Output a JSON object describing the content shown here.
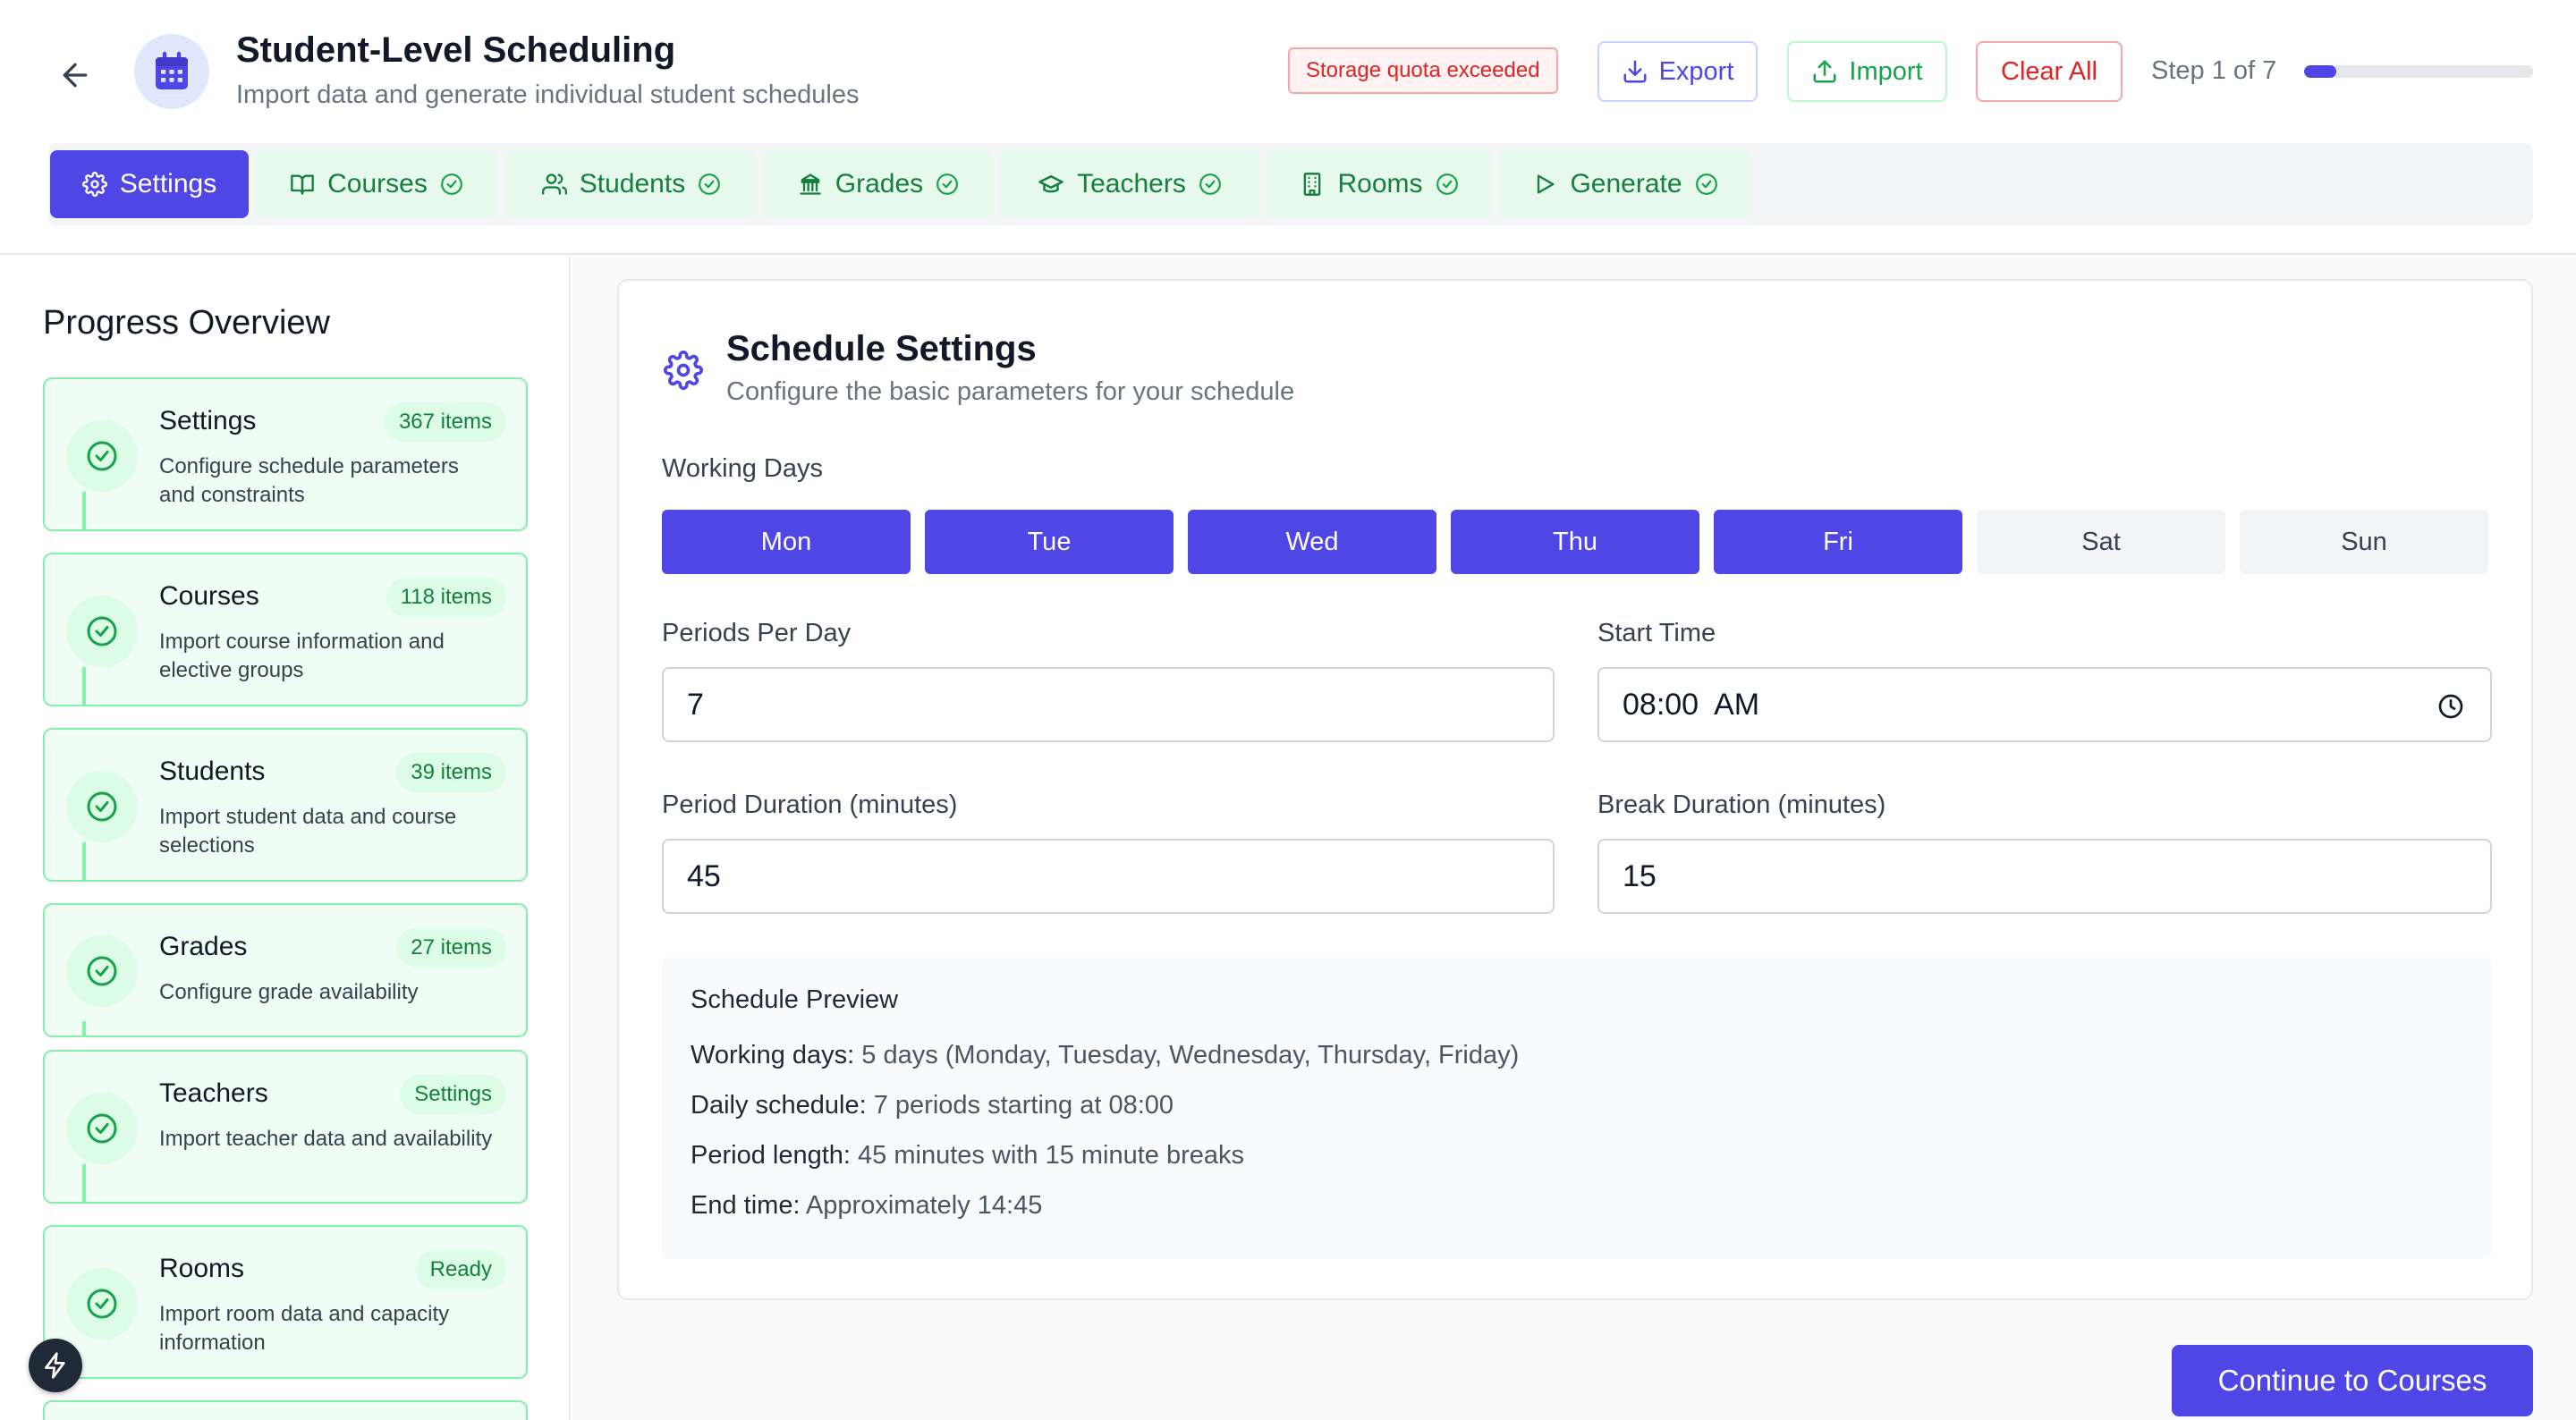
{
  "header": {
    "title": "Student-Level Scheduling",
    "subtitle": "Import data and generate individual student schedules",
    "quota_warning": "Storage quota exceeded",
    "export_label": "Export",
    "import_label": "Import",
    "clear_label": "Clear All",
    "step_text": "Step 1 of 7",
    "step_progress": 0.14
  },
  "tabs": [
    {
      "label": "Settings",
      "icon": "gear-icon",
      "active": true
    },
    {
      "label": "Courses",
      "icon": "book-icon",
      "done": true
    },
    {
      "label": "Students",
      "icon": "users-icon",
      "done": true
    },
    {
      "label": "Grades",
      "icon": "building-icon",
      "done": true
    },
    {
      "label": "Teachers",
      "icon": "graduation-cap-icon",
      "done": true
    },
    {
      "label": "Rooms",
      "icon": "office-icon",
      "done": true
    },
    {
      "label": "Generate",
      "icon": "play-icon",
      "done": true
    }
  ],
  "sidebar": {
    "title": "Progress Overview",
    "cards": [
      {
        "title": "Settings",
        "badge": "367 items",
        "desc": "Configure schedule parameters and constraints"
      },
      {
        "title": "Courses",
        "badge": "118 items",
        "desc": "Import course information and elective groups"
      },
      {
        "title": "Students",
        "badge": "39 items",
        "desc": "Import student data and course selections"
      },
      {
        "title": "Grades",
        "badge": "27 items",
        "desc": "Configure grade availability"
      },
      {
        "title": "Teachers",
        "badge": "Settings",
        "desc": "Import teacher data and availability"
      },
      {
        "title": "Rooms",
        "badge": "Ready",
        "desc": "Import room data and capacity information"
      }
    ]
  },
  "settings": {
    "title": "Schedule Settings",
    "subtitle": "Configure the basic parameters for your schedule",
    "working_days_label": "Working Days",
    "days": [
      {
        "label": "Mon",
        "selected": true
      },
      {
        "label": "Tue",
        "selected": true
      },
      {
        "label": "Wed",
        "selected": true
      },
      {
        "label": "Thu",
        "selected": true
      },
      {
        "label": "Fri",
        "selected": true
      },
      {
        "label": "Sat",
        "selected": false
      },
      {
        "label": "Sun",
        "selected": false
      }
    ],
    "periods_label": "Periods Per Day",
    "periods_value": "7",
    "start_time_label": "Start Time",
    "start_time_value": "08:00  AM",
    "period_duration_label": "Period Duration (minutes)",
    "period_duration_value": "45",
    "break_duration_label": "Break Duration (minutes)",
    "break_duration_value": "15"
  },
  "preview": {
    "title": "Schedule Preview",
    "lines": [
      {
        "key": "Working days:",
        "value": " 5 days (Monday, Tuesday, Wednesday, Thursday, Friday)"
      },
      {
        "key": "Daily schedule:",
        "value": " 7 periods starting at 08:00"
      },
      {
        "key": "Period length:",
        "value": " 45 minutes with 15 minute breaks"
      },
      {
        "key": "End time:",
        "value": " Approximately 14:45"
      }
    ]
  },
  "continue_label": "Continue to Courses",
  "colors": {
    "accent": "#4f46e5",
    "success": "#16a34a",
    "danger": "#dc2626"
  }
}
